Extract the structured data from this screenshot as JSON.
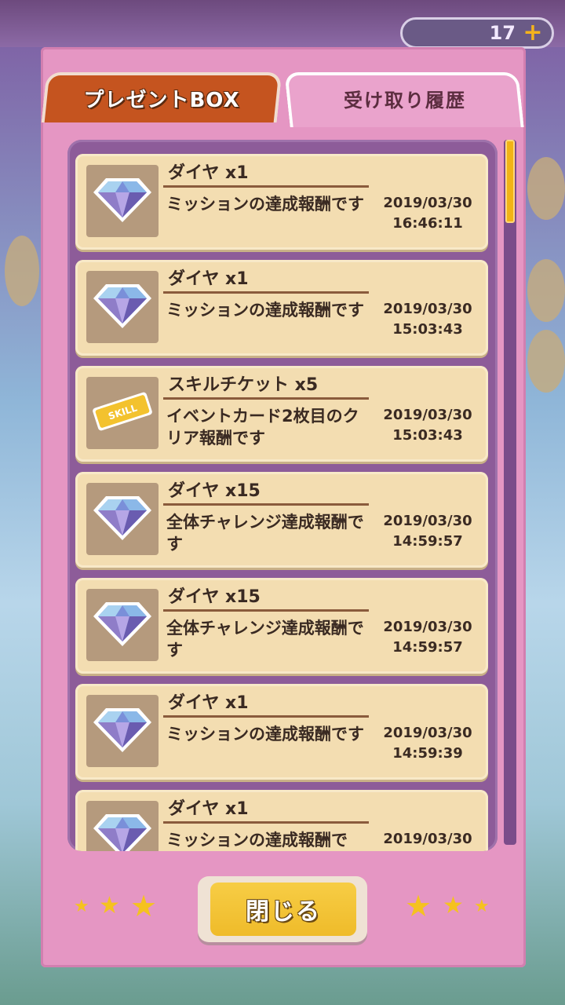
{
  "background": {
    "counter_value": "17"
  },
  "tabs": {
    "present_box": "プレゼントBOX",
    "history": "受け取り履歴"
  },
  "items": [
    {
      "icon": "diamond-icon",
      "title": "ダイヤ x1",
      "desc": "ミッションの達成報酬です",
      "date": "2019/03/30",
      "time": "16:46:11"
    },
    {
      "icon": "diamond-icon",
      "title": "ダイヤ x1",
      "desc": "ミッションの達成報酬です",
      "date": "2019/03/30",
      "time": "15:03:43"
    },
    {
      "icon": "skill-ticket-icon",
      "title": "スキルチケット x5",
      "desc": "イベントカード2枚目のクリア報酬です",
      "date": "2019/03/30",
      "time": "15:03:43"
    },
    {
      "icon": "diamond-icon",
      "title": "ダイヤ x15",
      "desc": "全体チャレンジ達成報酬です",
      "date": "2019/03/30",
      "time": "14:59:57"
    },
    {
      "icon": "diamond-icon",
      "title": "ダイヤ x15",
      "desc": "全体チャレンジ達成報酬です",
      "date": "2019/03/30",
      "time": "14:59:57"
    },
    {
      "icon": "diamond-icon",
      "title": "ダイヤ x1",
      "desc": "ミッションの達成報酬です",
      "date": "2019/03/30",
      "time": "14:59:39"
    },
    {
      "icon": "diamond-icon",
      "title": "ダイヤ x1",
      "desc": "ミッションの達成報酬で",
      "date": "2019/03/30",
      "time": ""
    }
  ],
  "close_button": "閉じる",
  "colors": {
    "panel": "#e596c3",
    "tab_active": "#c5541f",
    "list_bg": "#8d5c99",
    "item_bg": "#f3ddb1",
    "button": "#f7cd45",
    "star": "#f5c21f"
  }
}
